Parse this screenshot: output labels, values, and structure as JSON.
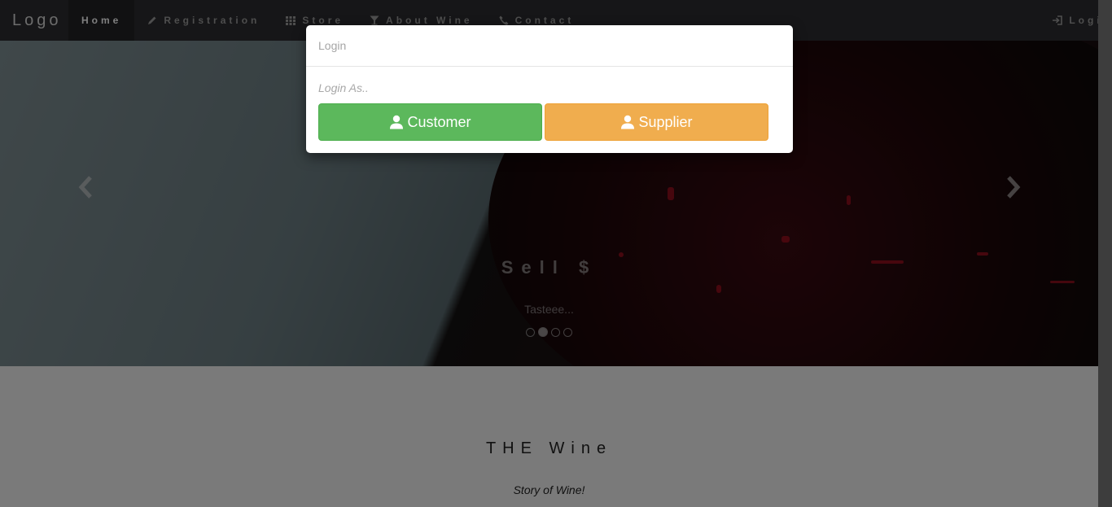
{
  "navbar": {
    "brand": "Logo",
    "items": [
      {
        "label": "Home",
        "icon": "none",
        "active": true
      },
      {
        "label": "Registration",
        "icon": "pencil-icon"
      },
      {
        "label": "Store",
        "icon": "grid-icon"
      },
      {
        "label": "About Wine",
        "icon": "glass-icon"
      },
      {
        "label": "Contact",
        "icon": "phone-icon"
      }
    ],
    "login": {
      "label": "Login",
      "icon": "login-icon"
    }
  },
  "carousel": {
    "caption_title": "Sell $",
    "caption_sub": "Tasteee...",
    "slide_count": 4,
    "active_slide": 2,
    "controls": {
      "prev": "chevron-left-icon",
      "next": "chevron-right-icon"
    }
  },
  "section": {
    "title": "THE Wine",
    "subtitle": "Story of Wine!"
  },
  "modal": {
    "title": "Login",
    "prompt": "Login As..",
    "buttons": [
      {
        "label": "Customer",
        "icon": "user-icon",
        "color": "#5cb85c"
      },
      {
        "label": "Supplier",
        "icon": "user-icon",
        "color": "#f0ad4e"
      }
    ]
  }
}
